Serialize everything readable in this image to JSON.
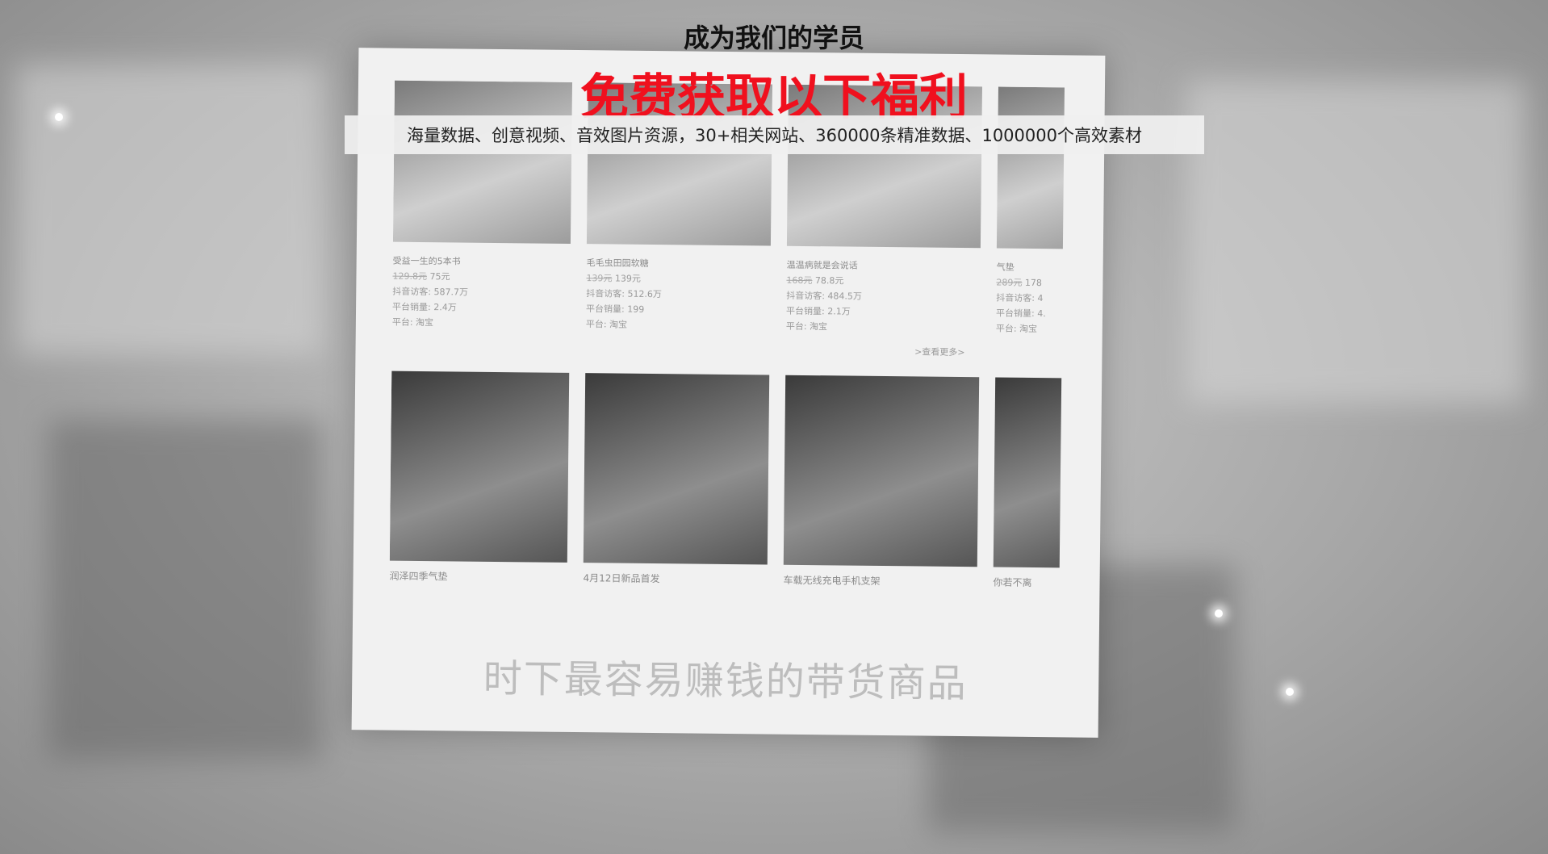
{
  "header": {
    "title": "成为我们的学员",
    "subtitle": "免费获取以下福利",
    "benefits": "海量数据、创意视频、音效图片资源，30+相关网站、360000条精准数据、1000000个高效素材"
  },
  "collage": {
    "banner": "时下最容易赚钱的带货商品",
    "products_top": [
      {
        "name": "受益一生的5本书",
        "price_old": "129.8元",
        "price_new": "75元",
        "views": "抖音访客: 587.7万",
        "sales": "平台销量: 2.4万",
        "platform": "平台: 淘宝"
      },
      {
        "name": "毛毛虫田园软糖",
        "price_old": "139元",
        "price_new": "139元",
        "views": "抖音访客: 512.6万",
        "sales": "平台销量: 199",
        "platform": "平台: 淘宝"
      },
      {
        "name": "温温病就是会说话",
        "price_old": "168元",
        "price_new": "78.8元",
        "views": "抖音访客: 484.5万",
        "sales": "平台销量: 2.1万",
        "platform": "平台: 淘宝"
      },
      {
        "name": "气垫",
        "price_old": "289元",
        "price_new": "178",
        "views": "抖音访客: 4",
        "sales": "平台销量: 4.",
        "platform": "平台: 淘宝"
      }
    ],
    "more_link": ">查看更多>",
    "products_bottom": [
      {
        "caption": "润泽四季气垫"
      },
      {
        "caption": "4月12日新品首发"
      },
      {
        "caption": "车载无线充电手机支架"
      },
      {
        "caption": "你若不离"
      }
    ]
  },
  "colors": {
    "accent": "#f0101e",
    "heading": "#111111"
  }
}
